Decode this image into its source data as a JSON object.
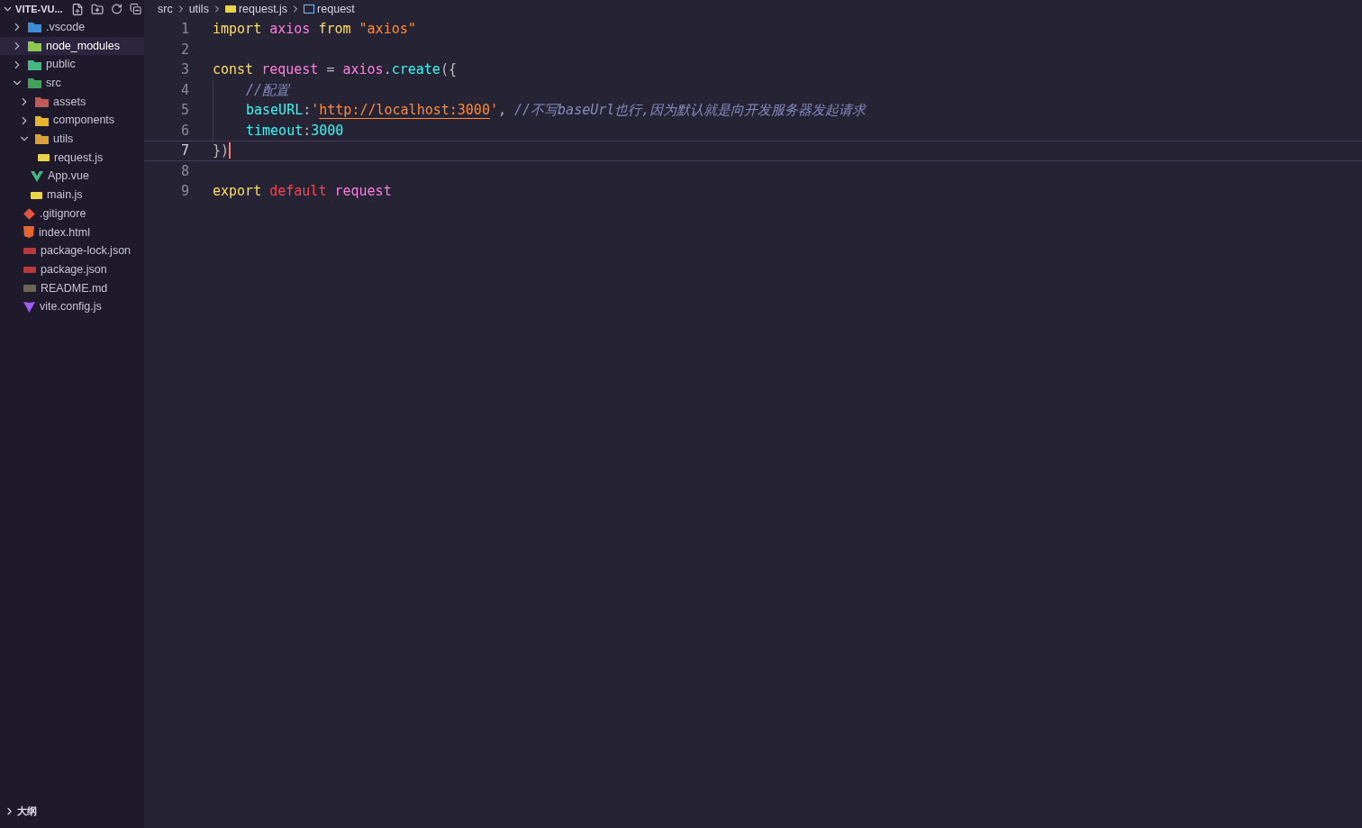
{
  "explorer": {
    "title": "VITE-VU...",
    "expanded": true,
    "tree": [
      {
        "label": ".vscode",
        "kind": "folder",
        "expanded": false,
        "selected": false
      },
      {
        "label": "node_modules",
        "kind": "folder",
        "expanded": false,
        "selected": true
      },
      {
        "label": "public",
        "kind": "folder",
        "expanded": false,
        "selected": false
      },
      {
        "label": "src",
        "kind": "folder",
        "expanded": true,
        "selected": false,
        "children": [
          {
            "label": "assets",
            "kind": "folder",
            "expanded": false,
            "selected": false
          },
          {
            "label": "components",
            "kind": "folder",
            "expanded": false,
            "selected": false
          },
          {
            "label": "utils",
            "kind": "folder",
            "expanded": true,
            "selected": false,
            "children": [
              {
                "label": "request.js",
                "kind": "js",
                "selected": false
              }
            ]
          },
          {
            "label": "App.vue",
            "kind": "vue",
            "selected": false
          },
          {
            "label": "main.js",
            "kind": "js",
            "selected": false
          }
        ]
      },
      {
        "label": ".gitignore",
        "kind": "git",
        "selected": false
      },
      {
        "label": "index.html",
        "kind": "html",
        "selected": false
      },
      {
        "label": "package-lock.json",
        "kind": "json",
        "selected": false
      },
      {
        "label": "package.json",
        "kind": "json",
        "selected": false
      },
      {
        "label": "README.md",
        "kind": "markdown",
        "selected": false
      },
      {
        "label": "vite.config.js",
        "kind": "vite",
        "selected": false
      }
    ]
  },
  "outline": {
    "title": "大纲",
    "expanded": false
  },
  "breadcrumbs": [
    {
      "label": "src",
      "kind": "folder"
    },
    {
      "label": "utils",
      "kind": "folder"
    },
    {
      "label": "request.js",
      "kind": "js"
    },
    {
      "label": "request",
      "kind": "symbol"
    }
  ],
  "editor": {
    "lines": [
      {
        "number": "1",
        "current": false,
        "indented": false,
        "tokens": [
          {
            "text": "import ",
            "kind": "keyword"
          },
          {
            "text": "axios ",
            "kind": "variable"
          },
          {
            "text": "from ",
            "kind": "keyword"
          },
          {
            "text": "\"axios\"",
            "kind": "string"
          }
        ]
      },
      {
        "number": "2",
        "current": false,
        "indented": false
      },
      {
        "number": "3",
        "current": false,
        "indented": false,
        "tokens": [
          {
            "text": "const ",
            "kind": "keyword"
          },
          {
            "text": "request",
            "kind": "variable"
          },
          {
            "text": " = ",
            "kind": "plain"
          },
          {
            "text": "axios",
            "kind": "variable"
          },
          {
            "text": ".",
            "kind": "plain"
          },
          {
            "text": "create",
            "kind": "function"
          },
          {
            "text": "({",
            "kind": "plain"
          }
        ]
      },
      {
        "number": "4",
        "current": false,
        "indented": true,
        "tokens": [
          {
            "text": "//配置",
            "kind": "comment"
          }
        ]
      },
      {
        "number": "5",
        "current": false,
        "indented": true,
        "tokens": [
          {
            "text": "baseURL",
            "kind": "property"
          },
          {
            "text": ":",
            "kind": "plain"
          },
          {
            "text": "'",
            "kind": "string"
          },
          {
            "text": "http://localhost:3000",
            "kind": "link"
          },
          {
            "text": "'",
            "kind": "string"
          },
          {
            "text": ", ",
            "kind": "plain"
          },
          {
            "text": "//不写baseUrl也行,因为默认就是向开发服务器发起请求",
            "kind": "comment"
          }
        ]
      },
      {
        "number": "6",
        "current": false,
        "indented": true,
        "tokens": [
          {
            "text": "timeout",
            "kind": "property"
          },
          {
            "text": ":",
            "kind": "plain"
          },
          {
            "text": "3000",
            "kind": "number"
          }
        ]
      },
      {
        "number": "7",
        "current": true,
        "indented": false,
        "tokens": [
          {
            "text": "})",
            "kind": "plain"
          }
        ]
      },
      {
        "number": "8",
        "current": false,
        "indented": false
      },
      {
        "number": "9",
        "current": false,
        "indented": false,
        "tokens": [
          {
            "text": "export ",
            "kind": "keyword"
          },
          {
            "text": "default ",
            "kind": "default"
          },
          {
            "text": "request",
            "kind": "variable"
          }
        ]
      }
    ]
  }
}
